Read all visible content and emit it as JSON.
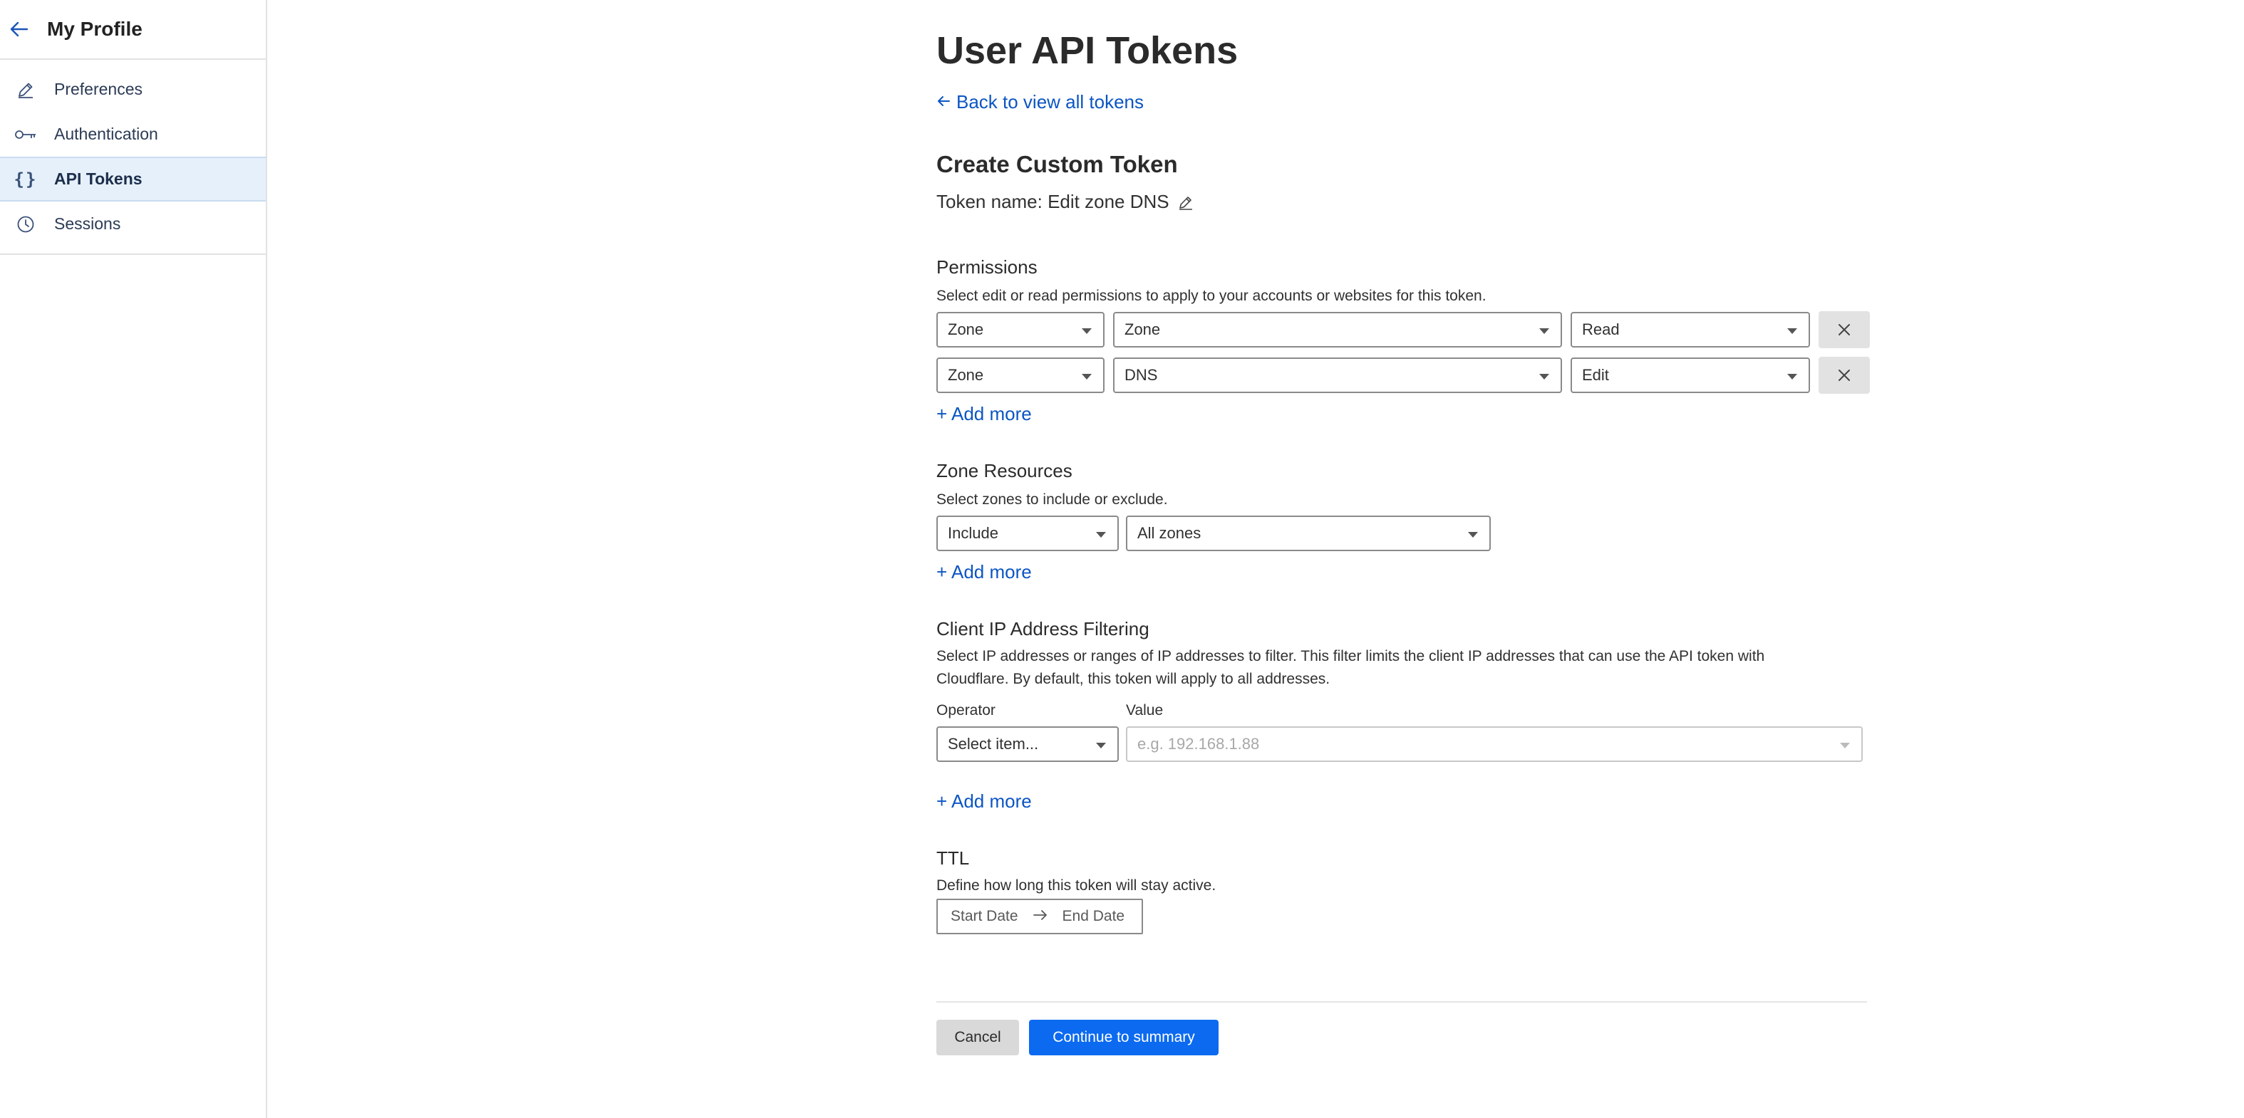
{
  "sidebar": {
    "title": "My Profile",
    "items": [
      {
        "label": "Preferences",
        "icon": "pencil-icon"
      },
      {
        "label": "Authentication",
        "icon": "key-icon"
      },
      {
        "label": "API Tokens",
        "icon": "braces-icon",
        "active": true
      },
      {
        "label": "Sessions",
        "icon": "clock-icon"
      }
    ]
  },
  "page": {
    "title": "User API Tokens",
    "back_link": "Back to view all tokens",
    "section_title": "Create Custom Token",
    "token_name": "Token name: Edit zone DNS"
  },
  "permissions": {
    "title": "Permissions",
    "description": "Select edit or read permissions to apply to your accounts or websites for this token.",
    "rows": [
      {
        "scope": "Zone",
        "resource": "Zone",
        "level": "Read"
      },
      {
        "scope": "Zone",
        "resource": "DNS",
        "level": "Edit"
      }
    ],
    "add_more": "+ Add more"
  },
  "zone_resources": {
    "title": "Zone Resources",
    "description": "Select zones to include or exclude.",
    "include": "Include",
    "zones": "All zones",
    "add_more": "+ Add more"
  },
  "ip_filtering": {
    "title": "Client IP Address Filtering",
    "description_line1": "Select IP addresses or ranges of IP addresses to filter. This filter limits the client IP addresses that can use the API token with",
    "description_line2": "Cloudflare. By default, this token will apply to all addresses.",
    "operator_label": "Operator",
    "value_label": "Value",
    "operator_value": "Select item...",
    "value_placeholder": "e.g. 192.168.1.88",
    "add_more": "+ Add more"
  },
  "ttl": {
    "title": "TTL",
    "description": "Define how long this token will stay active.",
    "start": "Start Date",
    "end": "End Date"
  },
  "actions": {
    "cancel": "Cancel",
    "continue": "Continue to summary"
  },
  "colors": {
    "link": "#0b55c4",
    "primary_button": "#0b6af0",
    "active_nav_bg": "#e6f0fb"
  }
}
